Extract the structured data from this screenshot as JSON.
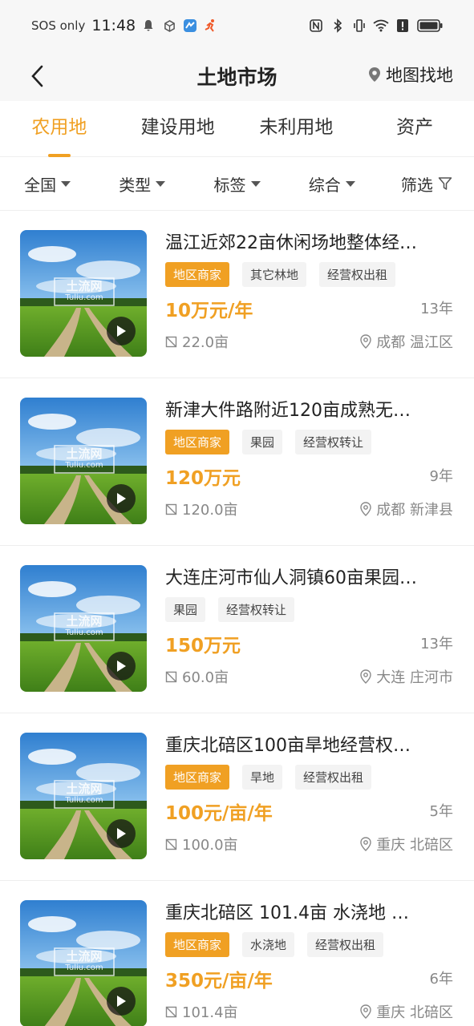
{
  "status_bar": {
    "carrier": "SOS only",
    "time": "11:48"
  },
  "nav": {
    "title": "土地市场",
    "map_link": "地图找地"
  },
  "tabs": [
    {
      "label": "农用地",
      "active": true
    },
    {
      "label": "建设用地",
      "active": false
    },
    {
      "label": "未利用地",
      "active": false
    },
    {
      "label": "资产",
      "active": false
    }
  ],
  "filters": [
    {
      "label": "全国"
    },
    {
      "label": "类型"
    },
    {
      "label": "标签"
    },
    {
      "label": "综合"
    },
    {
      "label": "筛选"
    }
  ],
  "colors": {
    "accent": "#f0a023",
    "tag_bg": "#f3f3f3",
    "muted": "#888888"
  },
  "listings": [
    {
      "title": "温江近郊22亩休闲场地整体经…",
      "tags": [
        {
          "text": "地区商家",
          "highlight": true
        },
        {
          "text": "其它林地",
          "highlight": false
        },
        {
          "text": "经营权出租",
          "highlight": false
        }
      ],
      "price": "10万元/年",
      "years": "13年",
      "area": "22.0亩",
      "location": "成都 温江区"
    },
    {
      "title": "新津大件路附近120亩成熟无…",
      "tags": [
        {
          "text": "地区商家",
          "highlight": true
        },
        {
          "text": "果园",
          "highlight": false
        },
        {
          "text": "经营权转让",
          "highlight": false
        }
      ],
      "price": "120万元",
      "years": "9年",
      "area": "120.0亩",
      "location": "成都 新津县"
    },
    {
      "title": "大连庄河市仙人洞镇60亩果园…",
      "tags": [
        {
          "text": "果园",
          "highlight": false
        },
        {
          "text": "经营权转让",
          "highlight": false
        }
      ],
      "price": "150万元",
      "years": "13年",
      "area": "60.0亩",
      "location": "大连 庄河市"
    },
    {
      "title": "重庆北碚区100亩旱地经营权…",
      "tags": [
        {
          "text": "地区商家",
          "highlight": true
        },
        {
          "text": "旱地",
          "highlight": false
        },
        {
          "text": "经营权出租",
          "highlight": false
        }
      ],
      "price": "100元/亩/年",
      "years": "5年",
      "area": "100.0亩",
      "location": "重庆 北碚区"
    },
    {
      "title": "重庆北碚区 101.4亩 水浇地 …",
      "tags": [
        {
          "text": "地区商家",
          "highlight": true
        },
        {
          "text": "水浇地",
          "highlight": false
        },
        {
          "text": "经营权出租",
          "highlight": false
        }
      ],
      "price": "350元/亩/年",
      "years": "6年",
      "area": "101.4亩",
      "location": "重庆 北碚区"
    }
  ],
  "watermark": {
    "brand": "土流网",
    "domain": "Tuliu.com"
  }
}
